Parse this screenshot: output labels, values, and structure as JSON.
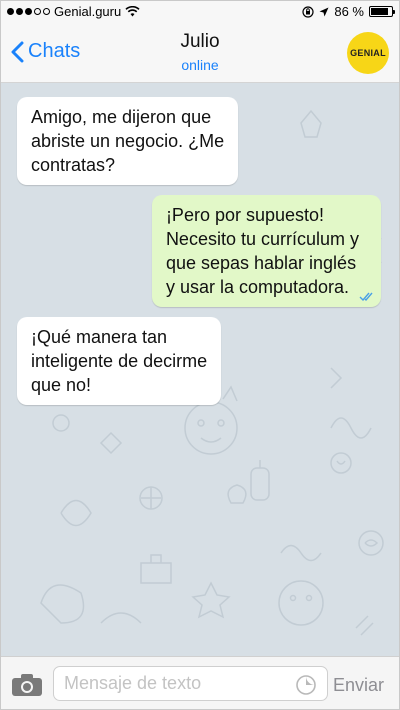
{
  "status_bar": {
    "carrier": "Genial.guru",
    "battery_percent": "86 %",
    "signal_filled": 3,
    "signal_total": 5,
    "battery_level": 0.86
  },
  "header": {
    "back_label": "Chats",
    "contact_name": "Julio",
    "contact_status": "online",
    "avatar_text": "GENIAL"
  },
  "messages": [
    {
      "direction": "incoming",
      "lines": [
        "Amigo, me dijeron que",
        "abriste un negocio. ¿Me",
        "contratas?"
      ]
    },
    {
      "direction": "outgoing",
      "lines": [
        "¡Pero por supuesto!",
        "Necesito tu currículum y",
        "que sepas hablar inglés",
        "y usar la computadora."
      ],
      "status": "read"
    },
    {
      "direction": "incoming",
      "lines": [
        "¡Qué manera tan",
        "inteligente de decirme",
        "que no!"
      ]
    }
  ],
  "input": {
    "placeholder": "Mensaje de texto",
    "send_label": "Enviar"
  },
  "colors": {
    "accent": "#1a82fb",
    "chat_background": "#d7dfe5",
    "outgoing_bubble": "#e2f8c8",
    "incoming_bubble": "#ffffff",
    "avatar": "#f7d617"
  }
}
